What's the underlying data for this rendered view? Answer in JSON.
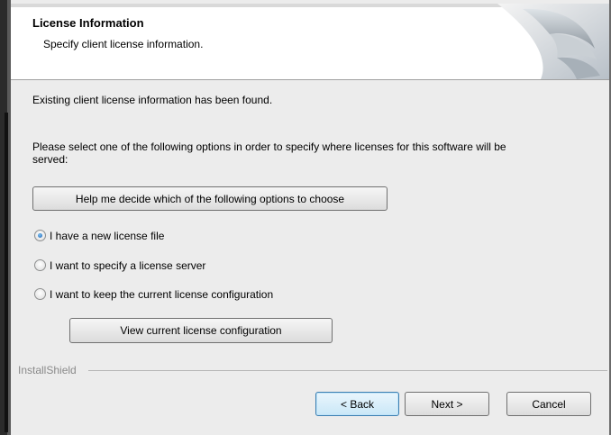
{
  "dialog": {
    "title": "License Information",
    "subtitle": "Specify client license information."
  },
  "body": {
    "found_text": "Existing client license information has been found.",
    "instructions": "Please select one of the following options in order to specify where licenses for this software will be served:",
    "help_button": "Help me decide which of the following options to choose",
    "options": [
      {
        "label": "I have a new license file",
        "checked": true
      },
      {
        "label": "I want to specify a license server",
        "checked": false
      },
      {
        "label": "I want to keep the current license configuration",
        "checked": false
      }
    ],
    "view_button": "View current license configuration"
  },
  "footer": {
    "brand": "InstallShield",
    "back_button": "< Back",
    "next_button": "Next >",
    "cancel_button": "Cancel"
  },
  "colors": {
    "accent": "#1a5fb4",
    "banner_bg": "#ffffff",
    "dialog_bg": "#ececec"
  }
}
